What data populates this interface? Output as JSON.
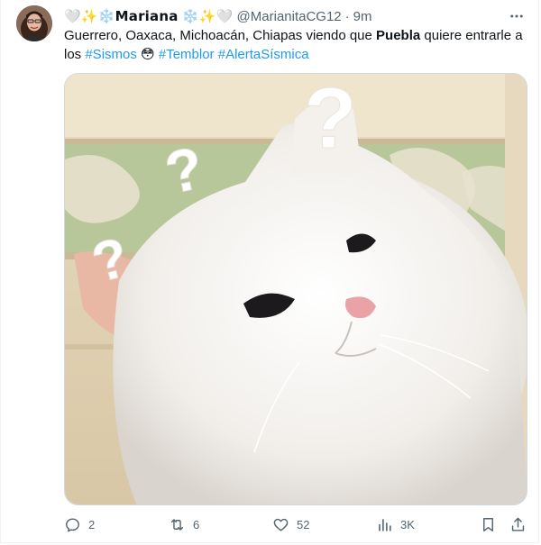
{
  "post": {
    "display_name": "🤍✨❄️𝗠𝗮𝗿𝗶𝗮𝗻𝗮 ❄️✨🤍",
    "handle": "@MarianitaCG12",
    "separator": "·",
    "time": "9m",
    "text": {
      "part1": "Guerrero, Oaxaca, Michoacán, Chiapas viendo que ",
      "bold": "Puebla",
      "part2": " quiere entrarle a los ",
      "tag1": "#Sismos",
      "emoji": " 😳 ",
      "tag2": "#Temblor",
      "space": " ",
      "tag3": "#AlertaSísmica"
    },
    "image": {
      "question_marks": [
        "?",
        "?",
        "?"
      ]
    }
  },
  "actions": {
    "replies": "2",
    "reposts": "6",
    "likes": "52",
    "views": "3K"
  },
  "colors": {
    "accent": "#1d9bf0",
    "muted": "#536471",
    "text": "#0f1419"
  }
}
